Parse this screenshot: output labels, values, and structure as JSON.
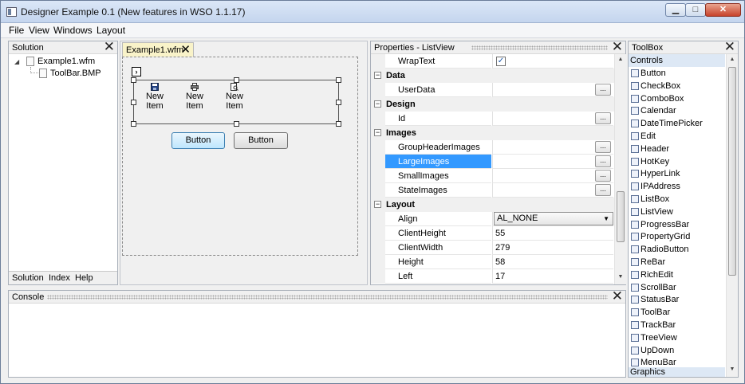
{
  "window": {
    "title": "Designer Example 0.1 (New features in WSO 1.1.17)",
    "controls": {
      "minimize": "▁",
      "maximize": "□",
      "close": "✕"
    }
  },
  "menu": [
    "File",
    "View",
    "Windows",
    "Layout"
  ],
  "solution": {
    "title": "Solution",
    "tree": [
      "Example1.wfm",
      "ToolBar.BMP"
    ],
    "tabs": [
      "Solution",
      "Index",
      "Help"
    ]
  },
  "designer": {
    "tab": "Example1.wfm",
    "toolbar_items": [
      {
        "label": "New Item",
        "icon": "save-icon"
      },
      {
        "label": "New Item",
        "icon": "print-icon"
      },
      {
        "label": "New Item",
        "icon": "print-preview-icon"
      }
    ],
    "buttons": [
      "Button",
      "Button"
    ]
  },
  "properties": {
    "title": "Properties - ListView",
    "wraptext_name": "WrapText",
    "categories": [
      "Data",
      "Design",
      "Images",
      "Layout"
    ],
    "data_props": [
      "UserData"
    ],
    "design_props": [
      "Id"
    ],
    "image_props": [
      "GroupHeaderImages",
      "LargeImages",
      "SmallImages",
      "StateImages"
    ],
    "layout_props": [
      {
        "name": "Align",
        "value": "AL_NONE"
      },
      {
        "name": "ClientHeight",
        "value": "55"
      },
      {
        "name": "ClientWidth",
        "value": "279"
      },
      {
        "name": "Height",
        "value": "58"
      },
      {
        "name": "Left",
        "value": "17"
      }
    ],
    "ellipsis": "..."
  },
  "toolbox": {
    "title": "ToolBox",
    "group_controls": "Controls",
    "group_graphics": "Graphics",
    "items": [
      "Button",
      "CheckBox",
      "ComboBox",
      "Calendar",
      "DateTimePicker",
      "Edit",
      "Header",
      "HotKey",
      "HyperLink",
      "IPAddress",
      "ListBox",
      "ListView",
      "ProgressBar",
      "PropertyGrid",
      "RadioButton",
      "ReBar",
      "RichEdit",
      "ScrollBar",
      "StatusBar",
      "ToolBar",
      "TrackBar",
      "TreeView",
      "UpDown",
      "MenuBar"
    ]
  },
  "console": {
    "title": "Console"
  }
}
